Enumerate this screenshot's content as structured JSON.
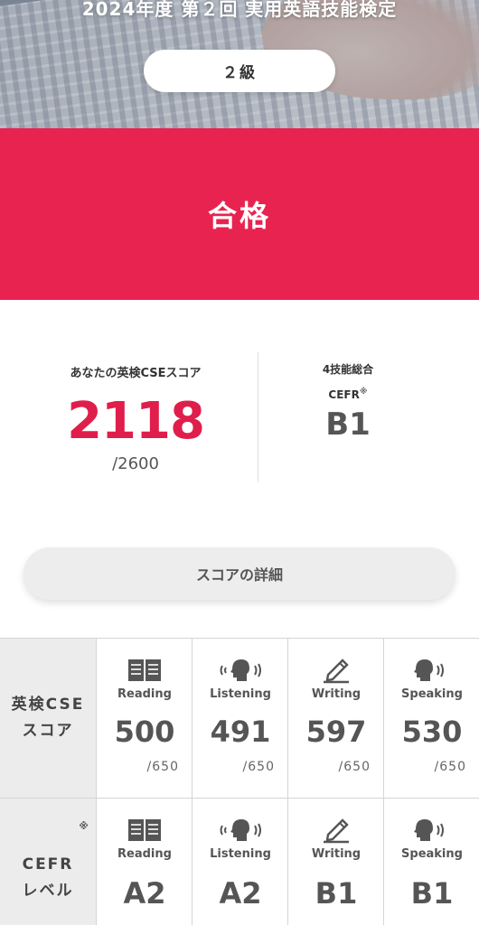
{
  "header": {
    "exam_title": "2024年度 第２回 実用英語技能検定",
    "grade": "２級"
  },
  "result": {
    "status": "合格"
  },
  "summary": {
    "cse_label": "あなたの英検CSEスコア",
    "cse_score": "2118",
    "cse_max": "/2600",
    "overall_label": "4技能総合",
    "cefr_label": "CEFR",
    "cefr_note_mark": "※",
    "cefr_value": "B1"
  },
  "detail_button": {
    "label": "スコアの詳細"
  },
  "score_grid": {
    "cse_row": {
      "label_line1": "英検CSE",
      "label_line2": "スコア",
      "items": [
        {
          "skill": "Reading",
          "icon": "book-icon",
          "value": "500",
          "max": "/650"
        },
        {
          "skill": "Listening",
          "icon": "listening-icon",
          "value": "491",
          "max": "/650"
        },
        {
          "skill": "Writing",
          "icon": "pencil-icon",
          "value": "597",
          "max": "/650"
        },
        {
          "skill": "Speaking",
          "icon": "speaking-icon",
          "value": "530",
          "max": "/650"
        }
      ]
    },
    "cefr_row": {
      "label_line1": "CEFR",
      "label_line2": "レベル",
      "note_mark": "※",
      "items": [
        {
          "skill": "Reading",
          "icon": "book-icon",
          "value": "A2"
        },
        {
          "skill": "Listening",
          "icon": "listening-icon",
          "value": "A2"
        },
        {
          "skill": "Writing",
          "icon": "pencil-icon",
          "value": "B1"
        },
        {
          "skill": "Speaking",
          "icon": "speaking-icon",
          "value": "B1"
        }
      ]
    }
  },
  "colors": {
    "accent_red": "#e8234f",
    "score_red": "#e01e4b"
  }
}
